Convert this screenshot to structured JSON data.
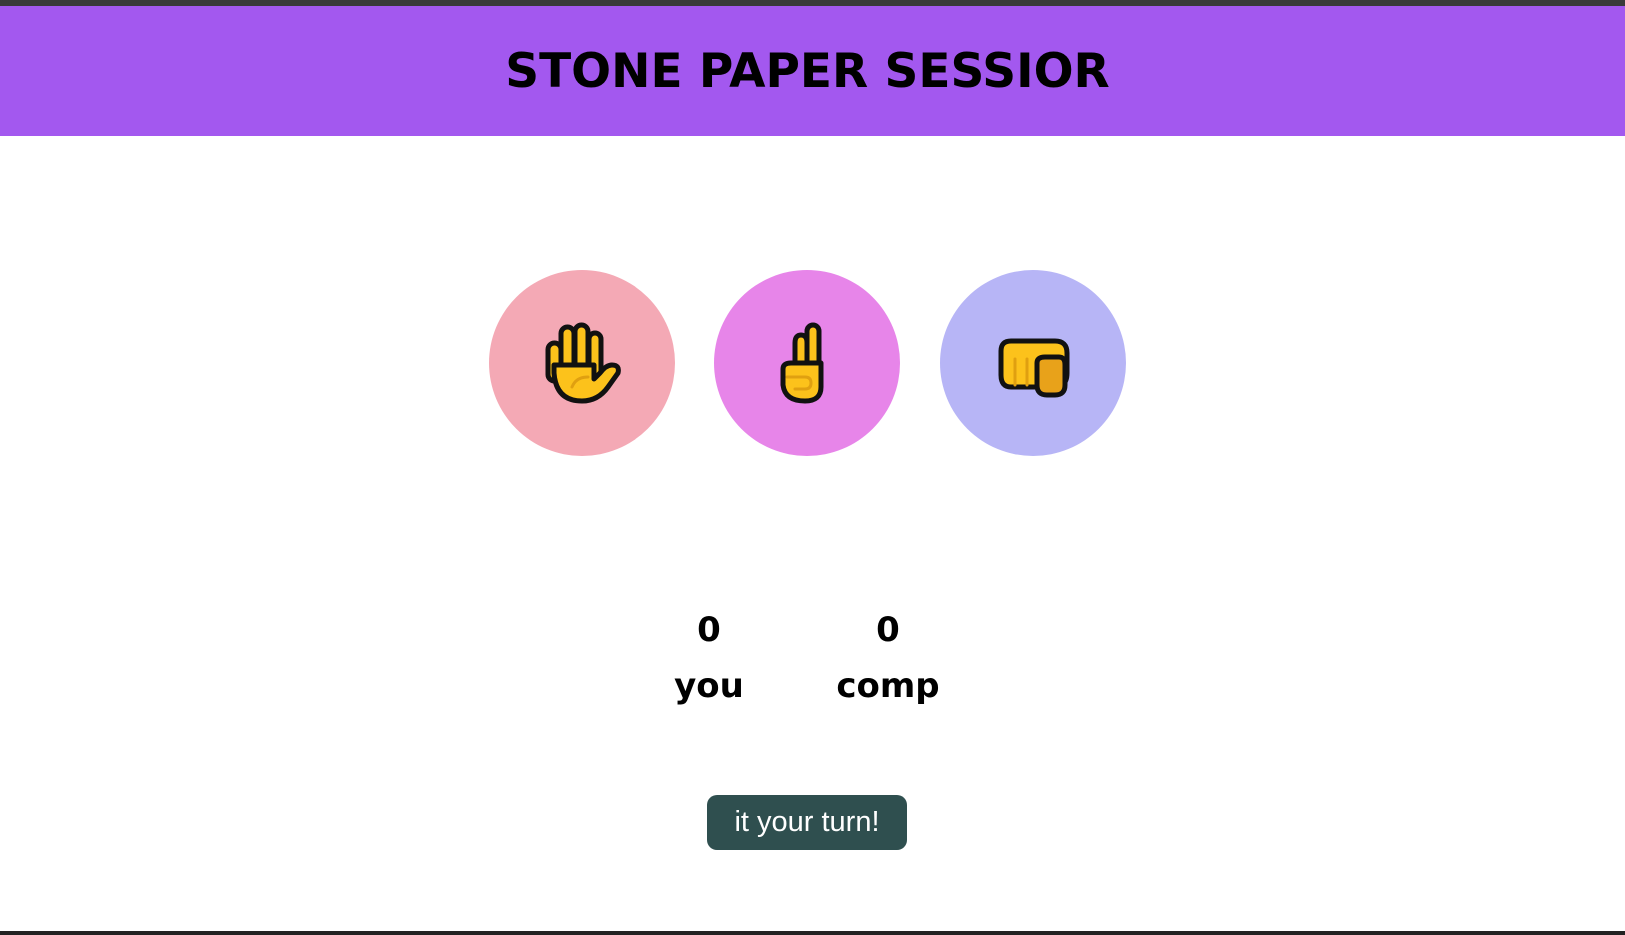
{
  "header": {
    "title": "STONE PAPER SESSIOR",
    "background": "#a358ef"
  },
  "choices": [
    {
      "name": "paper",
      "icon": "raised-hand-icon",
      "color": "#f4a9b5"
    },
    {
      "name": "scissors",
      "icon": "victory-hand-icon",
      "color": "#e785e9"
    },
    {
      "name": "stone",
      "icon": "raised-fist-icon",
      "color": "#b7b5f6"
    }
  ],
  "scoreboard": {
    "user": {
      "score": "0",
      "label": "you"
    },
    "comp": {
      "score": "0",
      "label": "comp"
    }
  },
  "message": {
    "text": "it your turn!",
    "background": "#2f4f4f"
  }
}
